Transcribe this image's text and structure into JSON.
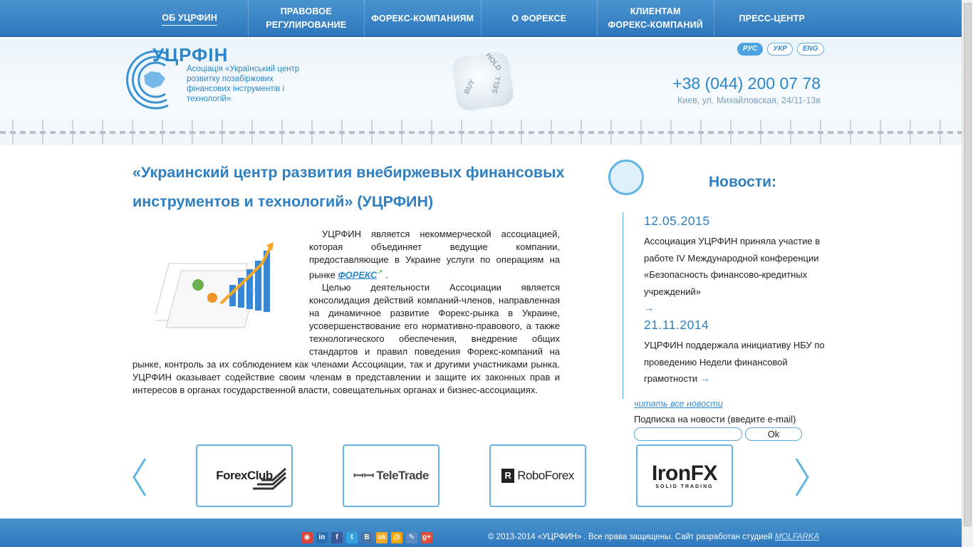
{
  "nav": {
    "items": [
      {
        "label": "ОБ УЦРФИН"
      },
      {
        "label": "ПРАВОВОЕ\nРЕГУЛИРОВАНИЕ"
      },
      {
        "label": "ФОРЕКС-КОМПАНИЯМ"
      },
      {
        "label": "О ФОРЕКСЕ"
      },
      {
        "label": "КЛИЕНТАМ\nФОРЕКС-КОМПАНИЙ"
      },
      {
        "label": "ПРЕСС-ЦЕНТР"
      }
    ]
  },
  "header": {
    "logo_title": "УЦРФІН",
    "logo_subtitle": "Асоціація «Український центр розвитку позабіржових фінансових інструментів і технологій»",
    "dice_words": [
      "HOLD",
      "BUY",
      "SELL"
    ],
    "languages": [
      "РУС",
      "УКР",
      "ENG"
    ],
    "phone": "+38 (044) 200 07 78",
    "address": "Киев, ул. Михайловская, 24/11-13в"
  },
  "main": {
    "headline": "«Украинский центр развития внебиржевых финансовых инструментов и технологий» (УЦРФИН)",
    "para1_before": "УЦРФИН является некоммерческой ассоциацией, которая объединяет ведущие компании, предоставляющие в Украине услуги по операциям на рынке ",
    "para1_link": "ФОРЕКС",
    "para1_after": " .",
    "para2": "Целью деятельности Ассоциации является консолидация действий компаний-членов, направленная на динамичное развитие Форекс-рынка в Украине, усовершенствование его нормативно-правового, а также технологического обеспечения, внедрение общих стандартов и правил поведения Форекс-компаний на рынке, контроль за их соблюдением как членами Ассоциации, так и другими участниками рынка. УЦРФИН оказывает содействие своим членам в представлении и защите их законных прав и интересов в органах государственной власти, совещательных органах и бизнес-ассоциациях."
  },
  "news": {
    "title": "Новости:",
    "items": [
      {
        "date": "12.05.2015",
        "text": "Ассоциация УЦРФИН приняла участие в работе IV Международной конференции «Безопасность финансово-кредитных учреждений»",
        "arrow": "→"
      },
      {
        "date": "21.11.2014",
        "text": "УЦРФИН поддержала инициативу НБУ по проведению Недели финансовой грамотности",
        "arrow": "→"
      }
    ],
    "all_link": "читать все новости",
    "subscribe_label": "Подписка на новости (введите e-mail)",
    "subscribe_value": "",
    "ok": "Ok"
  },
  "partners": [
    {
      "name": "ForexClub"
    },
    {
      "name": "TeleTrade"
    },
    {
      "name": "RoboForex"
    },
    {
      "name": "IronFX",
      "tagline": "SOLID TRADING"
    }
  ],
  "footer": {
    "social": [
      {
        "icon": "rss-icon",
        "glyph": "◉",
        "color": "#e0433a"
      },
      {
        "icon": "linkedin-icon",
        "glyph": "in",
        "color": "#2b6fb0"
      },
      {
        "icon": "facebook-icon",
        "glyph": "f",
        "color": "#3b5998"
      },
      {
        "icon": "twitter-icon",
        "glyph": "t",
        "color": "#38a1e0"
      },
      {
        "icon": "vk-icon",
        "glyph": "В",
        "color": "#4c75a3"
      },
      {
        "icon": "odnoklassniki-icon",
        "glyph": "ok",
        "color": "#f5a623"
      },
      {
        "icon": "mailru-icon",
        "glyph": "@",
        "color": "#f7a600"
      },
      {
        "icon": "livejournal-icon",
        "glyph": "✎",
        "color": "#5b8bbf"
      },
      {
        "icon": "googleplus-icon",
        "glyph": "g+",
        "color": "#dd4b39"
      }
    ],
    "copyright": "© 2013-2014 «УЦРФИН» . Все права защищены. Сайт разработан студией ",
    "studio": "MOLFARKA"
  }
}
